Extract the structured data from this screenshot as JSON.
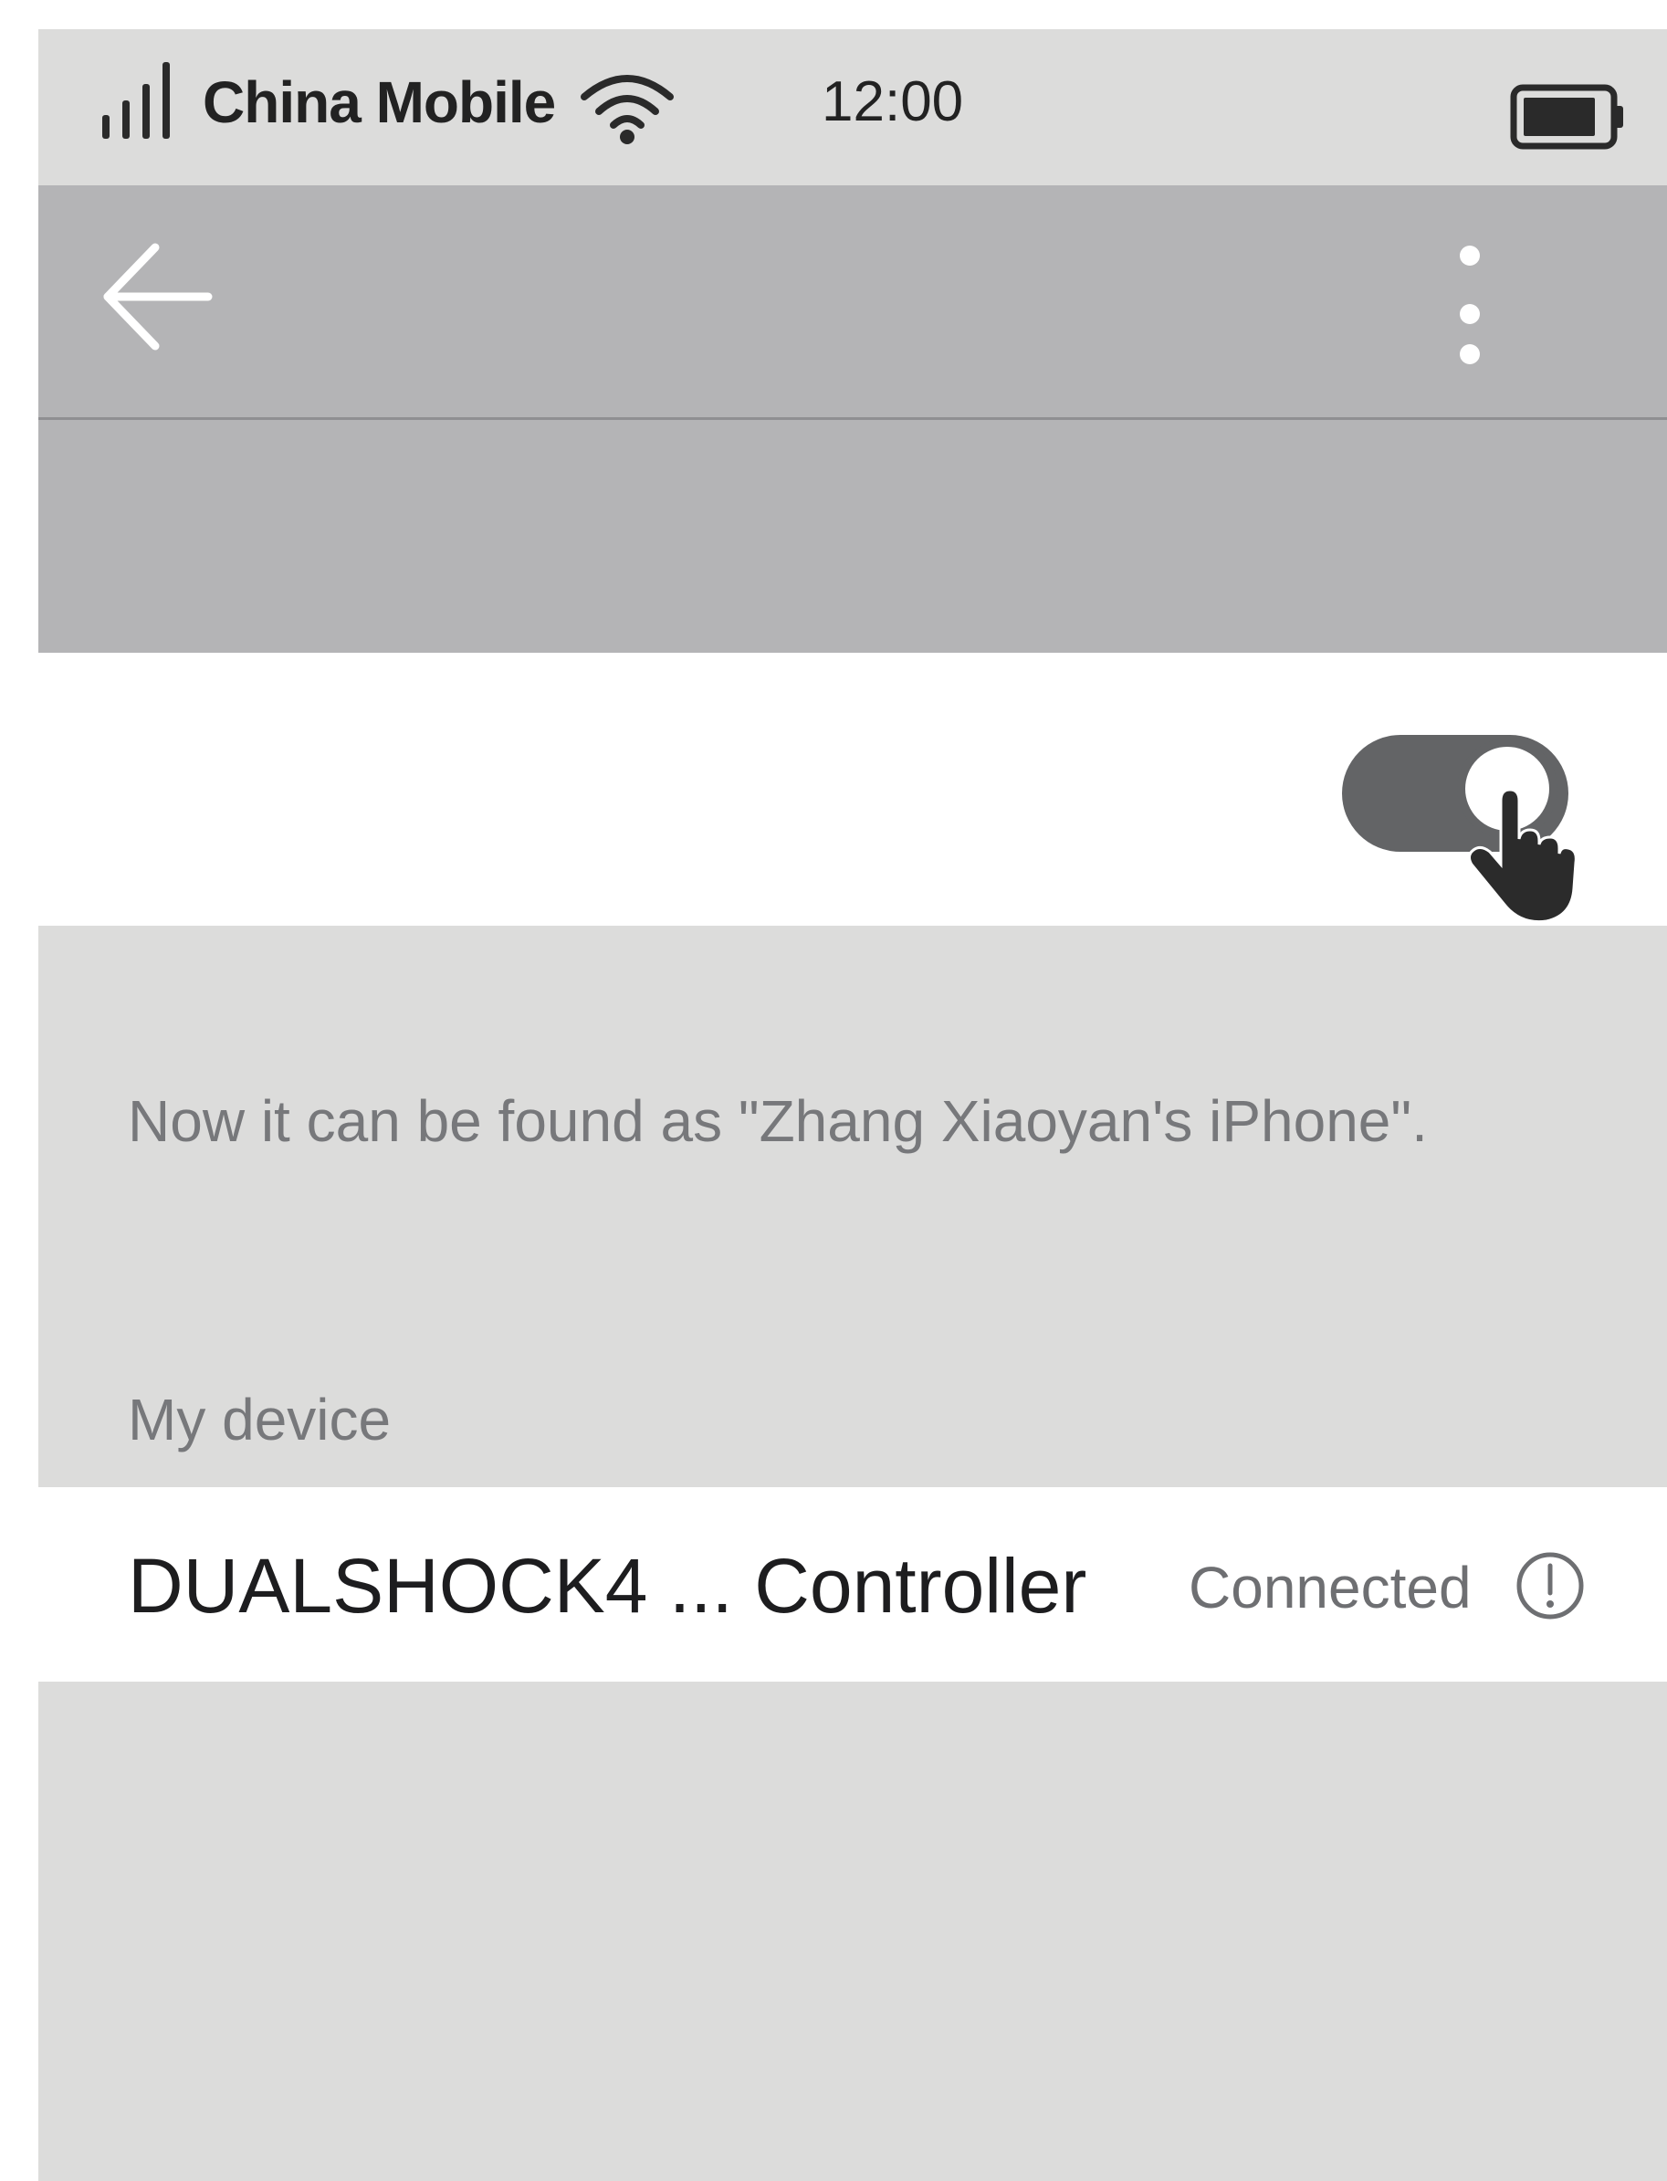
{
  "status_bar": {
    "carrier": "China Mobile",
    "time": "12:00",
    "icons": {
      "signal": "signal-bars-icon",
      "wifi": "wifi-icon",
      "battery": "battery-icon"
    }
  },
  "app_bar": {
    "icons": {
      "back": "back-arrow-icon",
      "more": "more-vertical-icon"
    }
  },
  "bluetooth_toggle": {
    "state": "on"
  },
  "discoverable_text": "Now it can be found as \"Zhang Xiaoyan's iPhone\".",
  "my_devices": {
    "header": "My device",
    "items": [
      {
        "name": "DUALSHOCK4 ... Controller",
        "status": "Connected",
        "icon": "info-icon"
      }
    ]
  },
  "colors": {
    "status_bar_bg": "#dcdcdb",
    "app_bar_bg": "#b4b4b6",
    "toggle_on": "#636466",
    "row_bg": "#ffffff",
    "secondary_text": "#77787b",
    "primary_text": "#1d1d1f"
  }
}
